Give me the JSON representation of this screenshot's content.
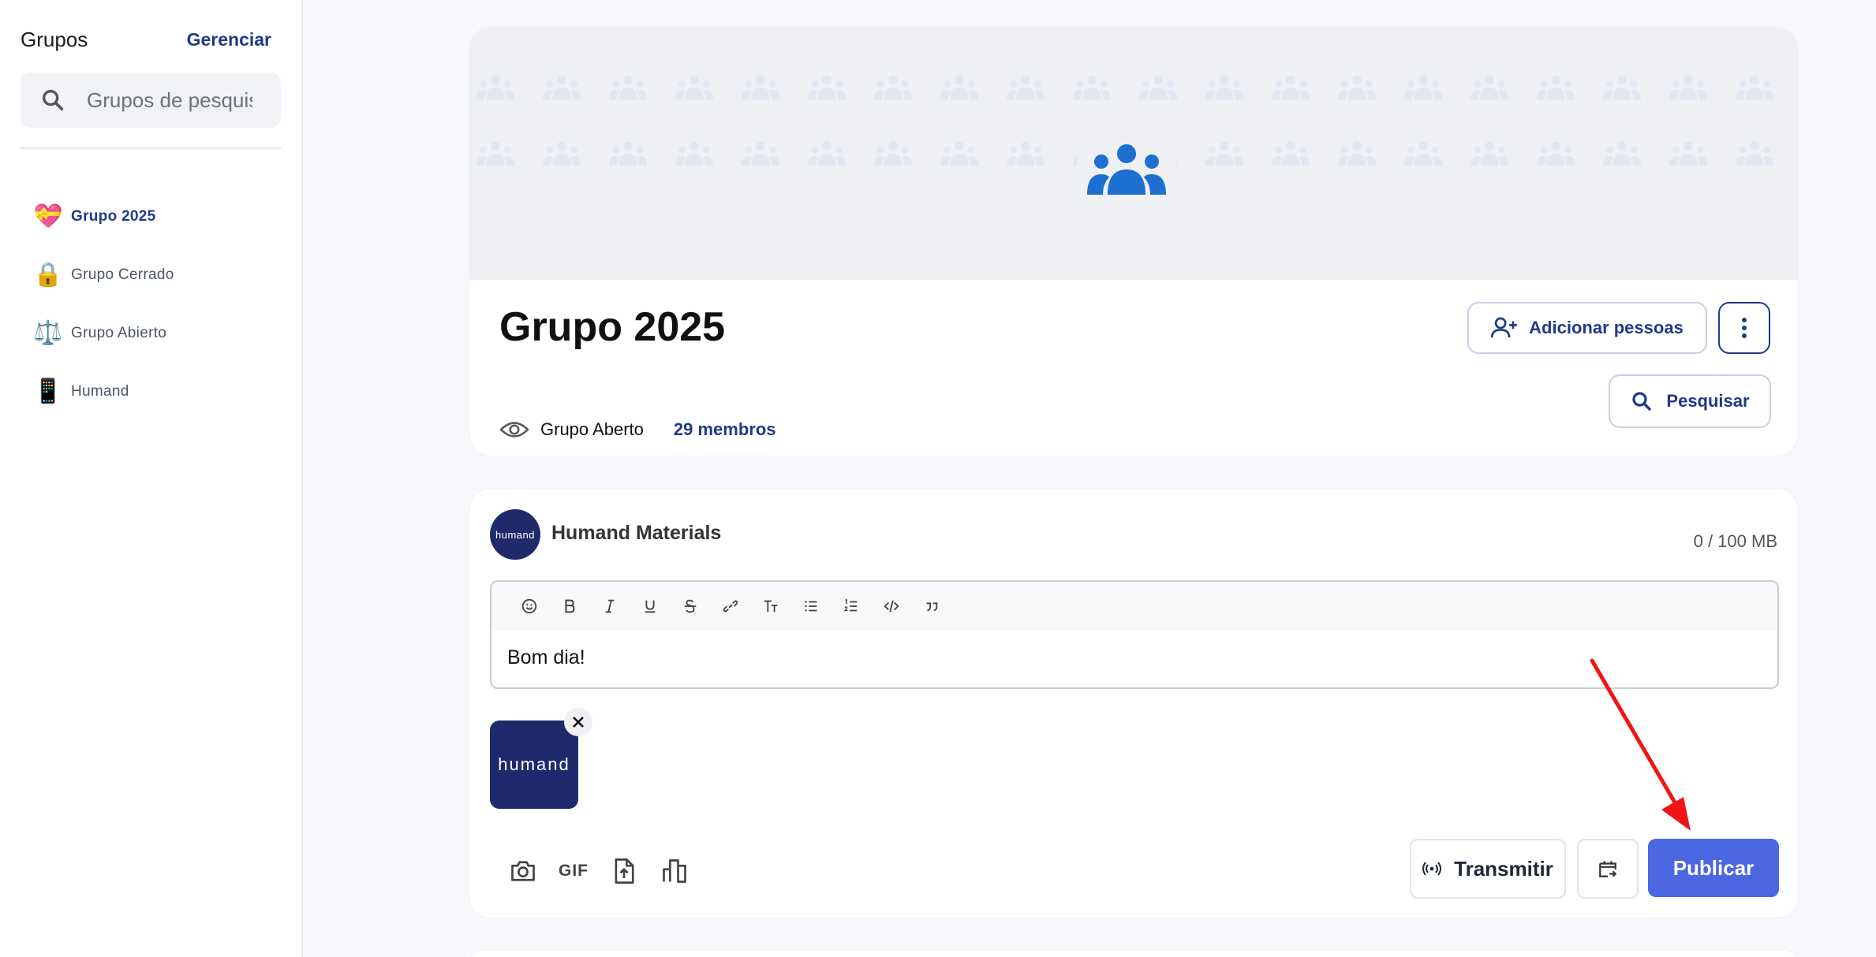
{
  "sidebar": {
    "title": "Grupos",
    "manage_label": "Gerenciar",
    "search_placeholder": "Grupos de pesquisa",
    "items": [
      {
        "label": "Grupo 2025",
        "emoji": "💝",
        "active": true
      },
      {
        "label": "Grupo Cerrado",
        "emoji": "🔒",
        "active": false
      },
      {
        "label": "Grupo Abierto",
        "emoji": "⚖️",
        "active": false
      },
      {
        "label": "Humand",
        "emoji": "📱",
        "active": false
      }
    ]
  },
  "group": {
    "title": "Grupo 2025",
    "type_label": "Grupo Aberto",
    "members_label": "29 membros",
    "add_people_label": "Adicionar pessoas",
    "search_label": "Pesquisar"
  },
  "composer": {
    "author": "Humand Materials",
    "avatar_text": "humand",
    "quota": "0 / 100 MB",
    "text": "Bom dia!",
    "thumbnail_text": "humand",
    "gif_label": "GIF",
    "stream_label": "Transmitir",
    "publish_label": "Publicar"
  },
  "colors": {
    "brand_dark": "#1e3a8a",
    "publish": "#4a66e0",
    "annotation_arrow": "#f01414",
    "group_icon": "#1f6fd1"
  }
}
